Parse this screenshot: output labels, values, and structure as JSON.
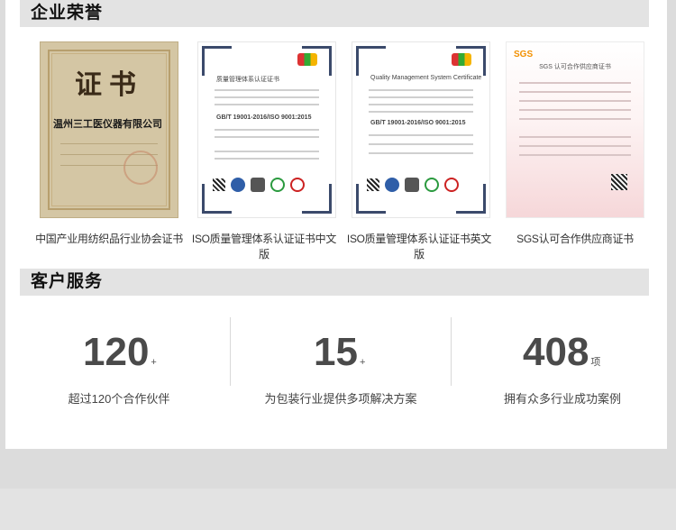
{
  "honors": {
    "title": "企业荣誉",
    "certificates": [
      {
        "caption": "中国产业用纺织品行业协会证书",
        "heading": "证书",
        "org_text": "温州三工医仪器有限公司"
      },
      {
        "caption": "ISO质量管理体系认证证书中文版",
        "heading": "质量管理体系认证证书",
        "std_text": "GB/T 19001-2016/ISO 9001:2015"
      },
      {
        "caption": "ISO质量管理体系认证证书英文版",
        "heading": "Quality Management System Certificate",
        "std_text": "GB/T 19001-2016/ISO 9001:2015"
      },
      {
        "caption": "SGS认可合作供应商证书",
        "heading": "SGS 认可合作供应商证书",
        "brand": "SGS"
      }
    ]
  },
  "service": {
    "title": "客户服务",
    "stats": [
      {
        "number": "120",
        "unit": "+",
        "label": "超过120个合作伙伴"
      },
      {
        "number": "15",
        "unit": "+",
        "label": "为包装行业提供多项解决方案"
      },
      {
        "number": "408",
        "unit": "项",
        "label": "拥有众多行业成功案例"
      }
    ]
  }
}
